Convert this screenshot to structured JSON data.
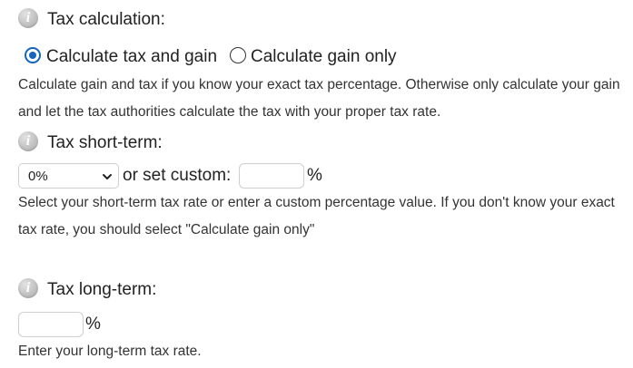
{
  "tax_calculation": {
    "label": "Tax calculation:",
    "info_icon": "info-icon",
    "options": [
      {
        "label": "Calculate tax and gain",
        "selected": true
      },
      {
        "label": "Calculate gain only",
        "selected": false
      }
    ],
    "help_text": "Calculate gain and tax if you know your exact tax percentage. Otherwise only calculate your gain and let the tax authorities calculate the tax with your proper tax rate."
  },
  "short_term": {
    "label": "Tax short-term:",
    "info_icon": "info-icon",
    "select_value": "0%",
    "or_text": "or set custom:",
    "custom_value": "",
    "percent_sign": "%",
    "help_text": "Select your short-term tax rate or enter a custom percentage value. If you don't know your exact tax rate, you should select \"Calculate gain only\""
  },
  "long_term": {
    "label": "Tax long-term:",
    "info_icon": "info-icon",
    "value": "",
    "percent_sign": "%",
    "help_text": "Enter your long-term tax rate."
  },
  "colors": {
    "accent": "#1565c0",
    "text": "#222222",
    "icon": "#c0c0c0",
    "input_border": "#cfcfcf"
  }
}
